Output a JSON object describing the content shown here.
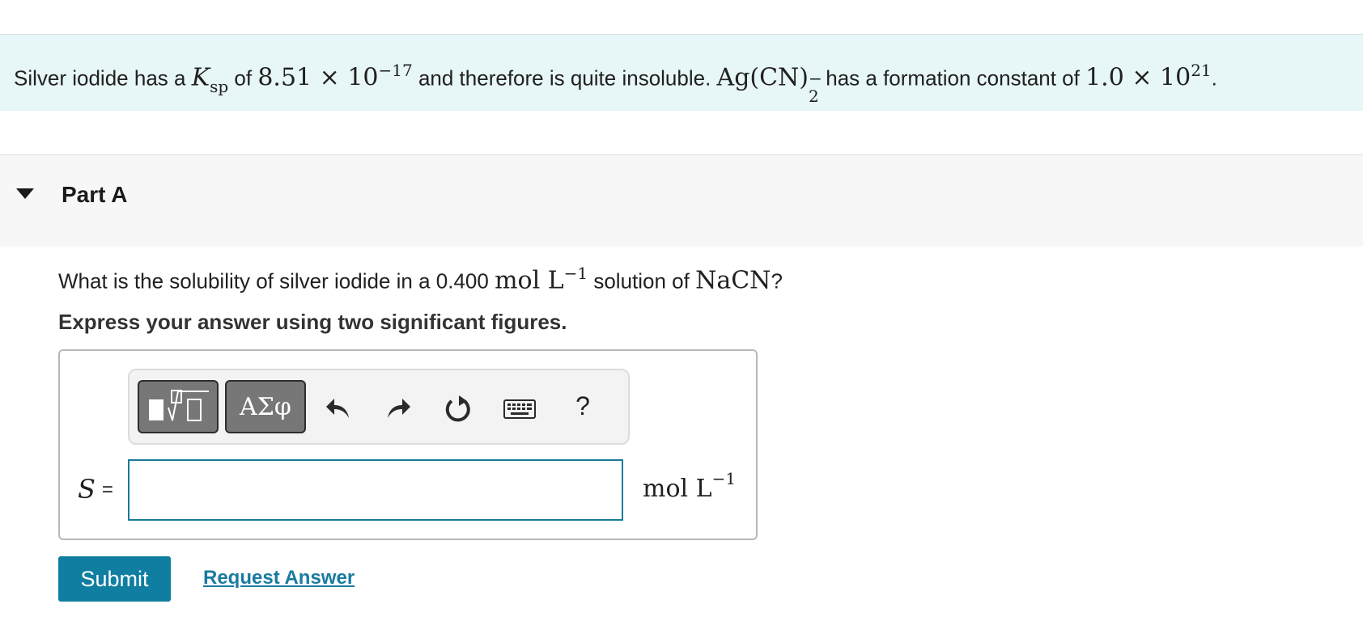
{
  "intro": {
    "t1": "Silver iodide has a ",
    "ksp_var": "K",
    "ksp_sub": "sp",
    "t2": " of ",
    "ksp_value": "8.51 × 10",
    "ksp_exp": "−17",
    "t3": " and therefore is quite insoluble. ",
    "complex": "Ag(CN)",
    "complex_sup": "−",
    "complex_sub": "2",
    "t4": " has a formation constant of ",
    "kf_value": "1.0 × 10",
    "kf_exp": "21",
    "t5": "."
  },
  "part": {
    "title": "Part A",
    "question": {
      "t1": "What is the solubility of silver iodide in a 0.400 ",
      "unit_base": "mol L",
      "unit_exp": "−1",
      "t2": " solution of ",
      "formula": "NaCN",
      "t3": "?"
    },
    "instruction": "Express your answer using two significant figures."
  },
  "toolbar": {
    "templates_icon": "templates-icon",
    "symbols_label": "ΑΣφ",
    "undo_icon": "undo-icon",
    "redo_icon": "redo-icon",
    "reset_icon": "reset-icon",
    "keyboard_icon": "keyboard-icon",
    "help_label": "?"
  },
  "answer": {
    "variable": "S",
    "equals": "=",
    "value": "",
    "unit_base": "mol L",
    "unit_exp": "−1"
  },
  "actions": {
    "submit_label": "Submit",
    "request_answer_label": "Request Answer"
  },
  "colors": {
    "intro_background": "#e7f6f6",
    "primary_button": "#0f7ea0",
    "link": "#1a7ba0",
    "input_border": "#1a7b9b"
  }
}
